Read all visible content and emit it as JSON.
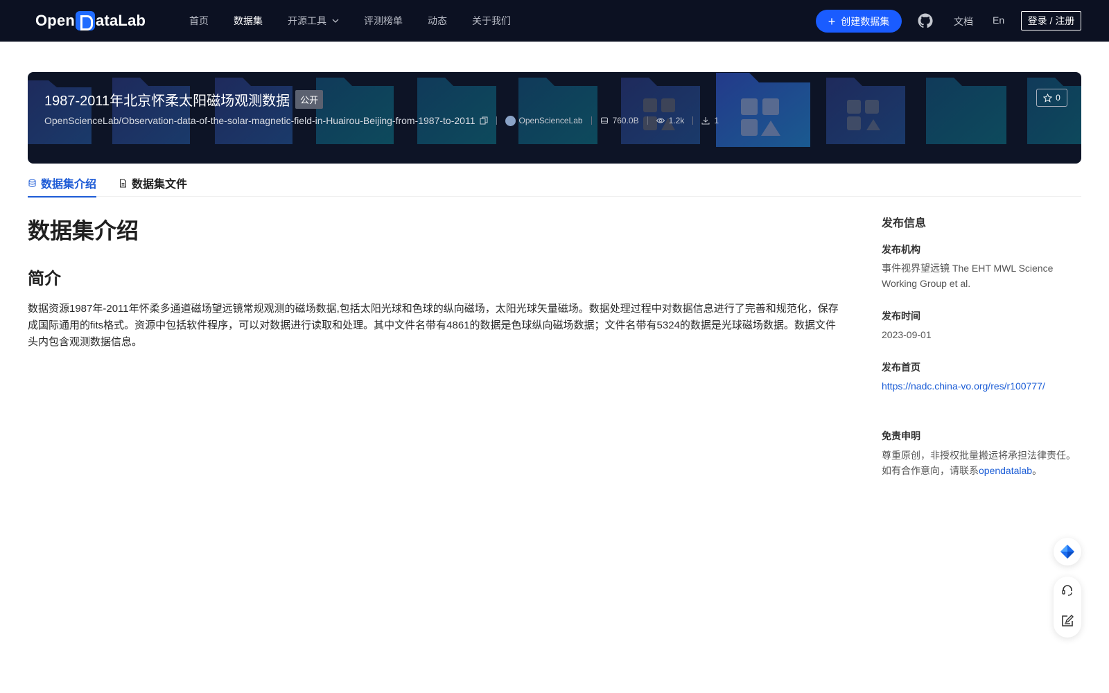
{
  "nav": {
    "logo_pre": "Open",
    "logo_post": "ataLab",
    "links": [
      "首页",
      "数据集",
      "开源工具",
      "评测榜单",
      "动态",
      "关于我们"
    ],
    "active": "数据集",
    "create_label": "创建数据集",
    "doc": "文档",
    "lang": "En",
    "login": "登录 / 注册"
  },
  "dataset": {
    "title": "1987-2011年北京怀柔太阳磁场观测数据",
    "badge": "公开",
    "path": "OpenScienceLab/Observation-data-of-the-solar-magnetic-field-in-Huairou-Beijing-from-1987-to-2011",
    "org": "OpenScienceLab",
    "size": "760.0B",
    "views": "1.2k",
    "downloads": "1",
    "stars": "0"
  },
  "tabs": [
    "数据集介绍",
    "数据集文件"
  ],
  "content": {
    "main_title": "数据集介绍",
    "section": "简介",
    "description": "数据资源1987年-2011年怀柔多通道磁场望远镜常规观测的磁场数据,包括太阳光球和色球的纵向磁场，太阳光球矢量磁场。数据处理过程中对数据信息进行了完善和规范化，保存成国际通用的fits格式。资源中包括软件程序，可以对数据进行读取和处理。其中文件名带有4861的数据是色球纵向磁场数据；文件名带有5324的数据是光球磁场数据。数据文件头内包含观测数据信息。"
  },
  "sidebar": {
    "heading": "发布信息",
    "org_label": "发布机构",
    "org_value": "事件视界望远镜 The EHT MWL Science Working Group et al.",
    "time_label": "发布时间",
    "time_value": "2023-09-01",
    "home_label": "发布首页",
    "home_value": "https://nadc.china-vo.org/res/r100777/",
    "disclaimer_label": "免责申明",
    "disclaimer_text": "尊重原创，非授权批量搬运将承担法律责任。如有合作意向，请联系",
    "disclaimer_link": "opendatalab",
    "disclaimer_end": "。"
  },
  "colors": {
    "nav_bg": "#0c1122",
    "accent": "#1a5cff",
    "tab_active": "#1d5bd6"
  }
}
